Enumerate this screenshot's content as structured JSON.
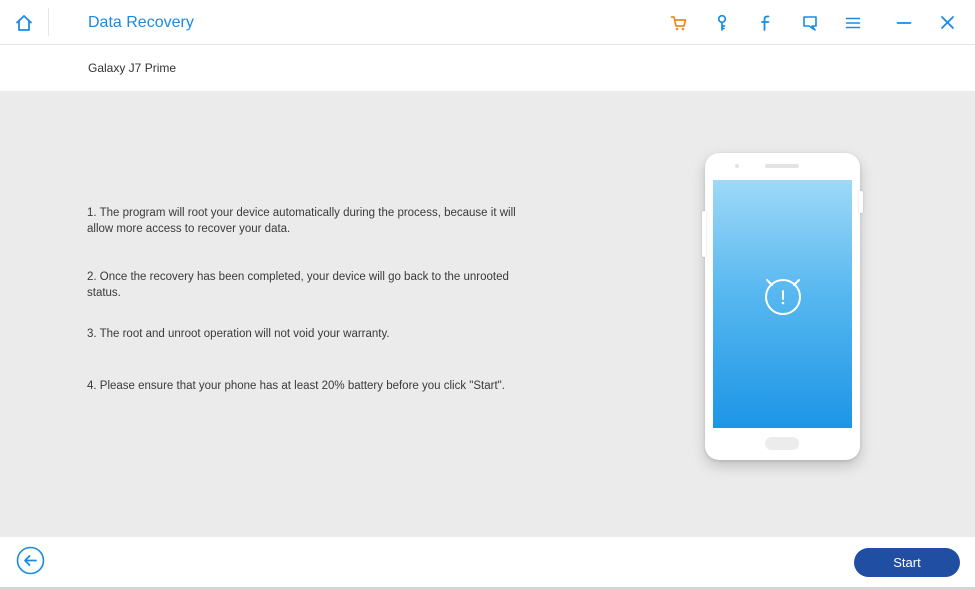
{
  "titlebar": {
    "title": "Data Recovery",
    "icons": {
      "home": "home-icon",
      "cart": "cart-icon",
      "key": "key-icon",
      "facebook": "facebook-icon",
      "feedback": "feedback-icon",
      "menu": "menu-icon",
      "minimize": "minimize-icon",
      "close": "close-icon"
    },
    "colors": {
      "title": "#1a8ae5",
      "icons": "#1a8ae5",
      "cart": "#f08a1c"
    }
  },
  "device": {
    "name": "Galaxy J7 Prime"
  },
  "instructions": [
    "1. The program will root your device automatically during the process, because it will allow more access to recover your data.",
    "2. Once the recovery has been completed, your device will go back to the unrooted status.",
    "3. The root and unroot operation will not void your warranty.",
    "4. Please ensure that your phone has at least 20% battery before you click \"Start\"."
  ],
  "illustration": {
    "phone_icon": "alarm-clock-icon"
  },
  "footer": {
    "back_icon": "arrow-left-circle-icon",
    "start_label": "Start",
    "start_color": "#1f4ea3"
  }
}
